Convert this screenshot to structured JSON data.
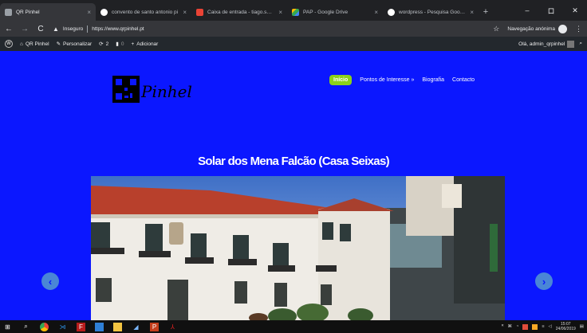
{
  "browser": {
    "tabs": [
      {
        "title": "QR Pinhel",
        "favicon_color": "#9aa0a6",
        "active": true
      },
      {
        "title": "convento de santo antonio pi",
        "favicon_color": "#ffffff",
        "active": false
      },
      {
        "title": "Caixa de entrada - tiago.sentic",
        "favicon_color": "#ea4335",
        "active": false
      },
      {
        "title": "PAP - Google Drive",
        "favicon_color": "#fbbc04",
        "active": false
      },
      {
        "title": "wordpress - Pesquisa Google",
        "favicon_color": "#ffffff",
        "active": false
      }
    ],
    "tab_close_glyph": "×",
    "new_tab_glyph": "+",
    "window_controls": {
      "minimize": "–",
      "maximize": "ロ",
      "close": "✕"
    },
    "address": {
      "security_label": "Inseguro",
      "url": "https://www.qrpinhel.pt"
    },
    "incognito_label": "Navegação anónima"
  },
  "adminbar": {
    "site_name": "QR Pinhel",
    "customize_label": "Personalizar",
    "updates_count": "2",
    "comments_count": "0",
    "add_label": "Adicionar",
    "greeting": "Olá, admin_qrpinhel"
  },
  "site": {
    "logo_text": "Pinhel",
    "nav": [
      "Início",
      "Pontos de Interesse »",
      "Biografia",
      "Contacto"
    ],
    "heading": "Solar dos Mena Falcão (Casa Seixas)",
    "prev_glyph": "‹",
    "next_glyph": "›"
  },
  "taskbar": {
    "clock_time": "15:07",
    "clock_date": "24/06/2019"
  },
  "colors": {
    "site_background": "#0b17ff",
    "active_nav": "#8bd11a",
    "slider_arrow": "#4a86d6"
  }
}
